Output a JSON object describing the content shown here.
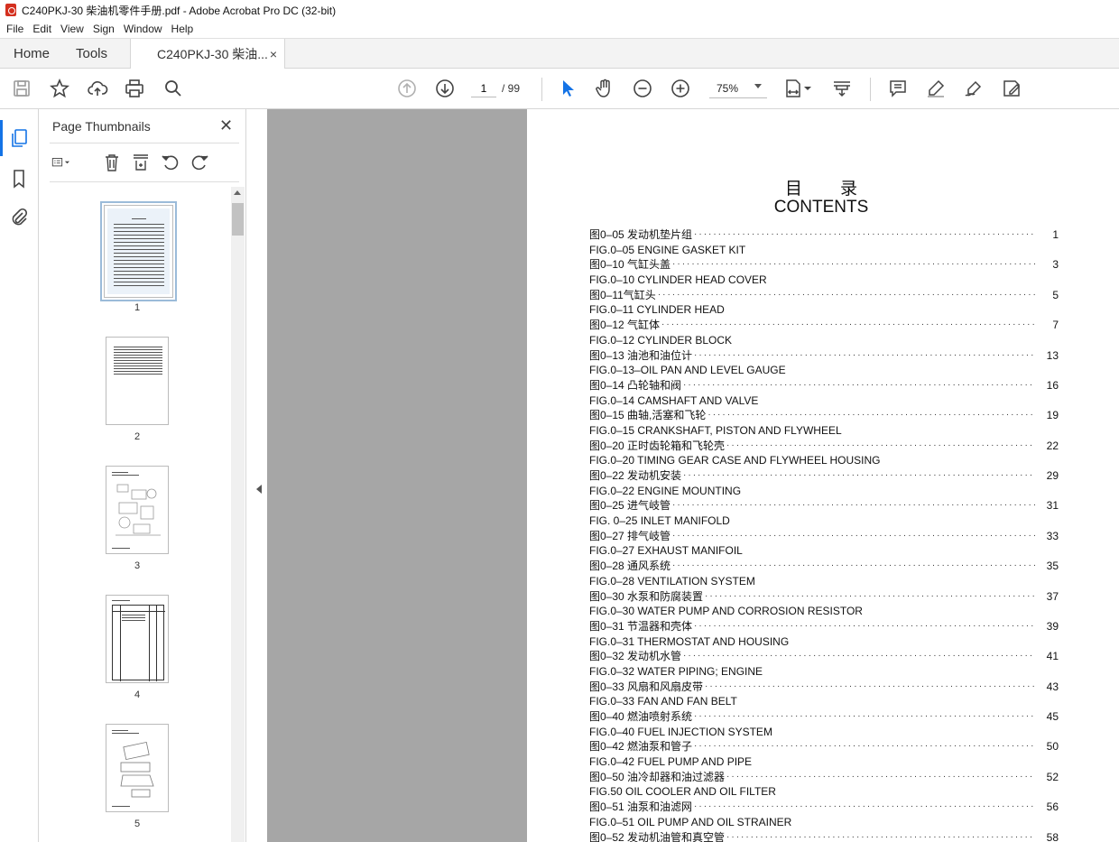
{
  "window": {
    "title": "C240PKJ-30 柴油机零件手册.pdf - Adobe Acrobat Pro DC (32-bit)"
  },
  "menu": [
    "File",
    "Edit",
    "View",
    "Sign",
    "Window",
    "Help"
  ],
  "tabs": {
    "home": "Home",
    "tools": "Tools",
    "doc": "C240PKJ-30 柴油...",
    "close": "×"
  },
  "toolbar": {
    "page_current": "1",
    "page_total": "/ 99",
    "zoom": "75%",
    "icons": [
      "save-icon",
      "star-icon",
      "upload-icon",
      "print-icon",
      "search-icon",
      "page-up-icon",
      "page-down-icon",
      "pointer-icon",
      "hand-icon",
      "zoom-out-icon",
      "zoom-in-icon",
      "fit-page-icon",
      "scroll-mode-icon",
      "comment-icon",
      "highlight-icon",
      "sign-icon",
      "fill-sign-icon"
    ]
  },
  "sidebar": {
    "panel_title": "Page Thumbnails",
    "close": "✕",
    "thumbnails": [
      {
        "label": "1"
      },
      {
        "label": "2"
      },
      {
        "label": "3"
      },
      {
        "label": "4"
      },
      {
        "label": "5"
      }
    ]
  },
  "document": {
    "title_cn": "目录",
    "title_en": "CONTENTS",
    "toc": [
      {
        "cn": "图0–05 发动机垫片组",
        "page": "1",
        "en": "FIG.0–05 ENGINE GASKET KIT"
      },
      {
        "cn": "图0–10 气缸头盖",
        "page": "3",
        "en": "FIG.0–10 CYLINDER HEAD COVER"
      },
      {
        "cn": "图0–11气缸头 ",
        "page": "5",
        "en": "FIG.0–11 CYLINDER HEAD"
      },
      {
        "cn": "图0–12 气缸体",
        "page": "7",
        "en": "FIG.0–12 CYLINDER BLOCK"
      },
      {
        "cn": "图0–13 油池和油位计",
        "page": "13",
        "en": "FIG.0–13–OIL PAN AND LEVEL GAUGE"
      },
      {
        "cn": "图0–14 凸轮轴和阀",
        "page": "16",
        "en": "FIG.0–14 CAMSHAFT AND VALVE"
      },
      {
        "cn": "图0–15 曲轴,活塞和飞轮 ",
        "page": "19",
        "en": "FIG.0–15 CRANKSHAFT, PISTON AND FLYWHEEL"
      },
      {
        "cn": "图0–20 正时齿轮箱和飞轮壳 ",
        "page": "22",
        "en": "FIG.0–20 TIMING GEAR CASE AND FLYWHEEL HOUSING"
      },
      {
        "cn": "图0–22 发动机安装",
        "page": "29",
        "en": "FIG.0–22 ENGINE MOUNTING"
      },
      {
        "cn": "图0–25 进气岐管",
        "page": "31",
        "en": "FIG. 0–25 INLET MANIFOLD"
      },
      {
        "cn": "图0–27 排气岐管",
        "page": "33",
        "en": "FIG.0–27 EXHAUST MANIFOIL"
      },
      {
        "cn": "图0–28 通风系统",
        "page": "35",
        "en": "FIG.0–28 VENTILATION SYSTEM"
      },
      {
        "cn": "图0–30 水泵和防腐装置",
        "page": "37",
        "en": "FIG.0–30 WATER PUMP AND CORROSION RESISTOR"
      },
      {
        "cn": "图0–31 节温器和壳体",
        "page": "39",
        "en": "FIG.0–31 THERMOSTAT AND HOUSING"
      },
      {
        "cn": "图0–32 发动机水管 ",
        "page": "41",
        "en": "FIG.0–32 WATER PIPING; ENGINE"
      },
      {
        "cn": "图0–33 风扇和风扇皮带",
        "page": "43",
        "en": "FIG.0–33 FAN AND FAN BELT"
      },
      {
        "cn": "图0–40 燃油喷射系统",
        "page": "45",
        "en": "FIG.0–40 FUEL INJECTION SYSTEM"
      },
      {
        "cn": "图0–42 燃油泵和管子",
        "page": "50",
        "en": "FIG.0–42 FUEL PUMP AND PIPE"
      },
      {
        "cn": "图0–50 油冷却器和油过滤器 ",
        "page": "52",
        "en": "FIG.50 OIL COOLER AND OIL FILTER"
      },
      {
        "cn": "图0–51 油泵和油滤网",
        "page": "56",
        "en": "FIG.0–51 OIL PUMP AND OIL STRAINER"
      },
      {
        "cn": "图0–52 发动机油管和真空管 ",
        "page": "58",
        "en": ""
      }
    ]
  }
}
